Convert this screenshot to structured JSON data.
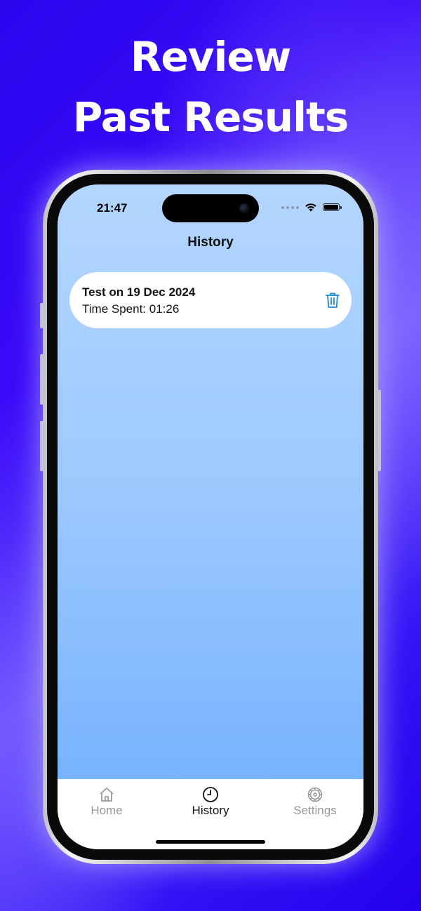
{
  "promo": {
    "headline_line1": "Review",
    "headline_line2": "Past Results"
  },
  "status_bar": {
    "time": "21:47"
  },
  "nav": {
    "title": "History"
  },
  "history": {
    "items": [
      {
        "title": "Test on 19 Dec 2024",
        "time_spent": "Time Spent: 01:26",
        "action_icon": "trash-icon"
      }
    ]
  },
  "tabbar": {
    "tabs": [
      {
        "label": "Home",
        "icon": "house-icon",
        "active": false
      },
      {
        "label": "History",
        "icon": "clock-icon",
        "active": true
      },
      {
        "label": "Settings",
        "icon": "gear-icon",
        "active": false
      }
    ]
  },
  "colors": {
    "accent": "#1a8ad9",
    "background_top": "#b3d6ff",
    "background_bottom": "#6eaeff",
    "promo_background": "#2a05ee"
  }
}
